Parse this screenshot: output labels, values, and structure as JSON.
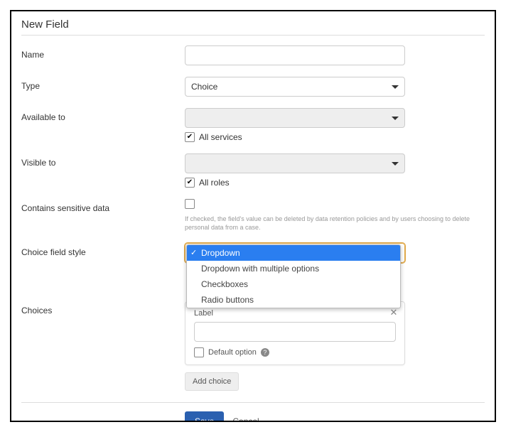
{
  "title": "New Field",
  "labels": {
    "name": "Name",
    "type": "Type",
    "available_to": "Available to",
    "visible_to": "Visible to",
    "sensitive": "Contains sensitive data",
    "style": "Choice field style",
    "choices": "Choices"
  },
  "fields": {
    "name_value": "",
    "type_value": "Choice",
    "available_to_value": "",
    "all_services_checked": true,
    "all_services_label": "All services",
    "visible_to_value": "",
    "all_roles_checked": true,
    "all_roles_label": "All roles",
    "sensitive_checked": false,
    "sensitive_helper": "If checked, the field's value can be deleted by data retention policies and by users choosing to delete personal data from a case."
  },
  "style_menu": {
    "options": [
      "Dropdown",
      "Dropdown with multiple options",
      "Checkboxes",
      "Radio buttons"
    ],
    "selected_index": 0
  },
  "choice_card": {
    "label_heading": "Label",
    "label_value": "",
    "default_option_label": "Default option"
  },
  "buttons": {
    "add_choice": "Add choice",
    "save": "Save",
    "cancel": "Cancel"
  }
}
